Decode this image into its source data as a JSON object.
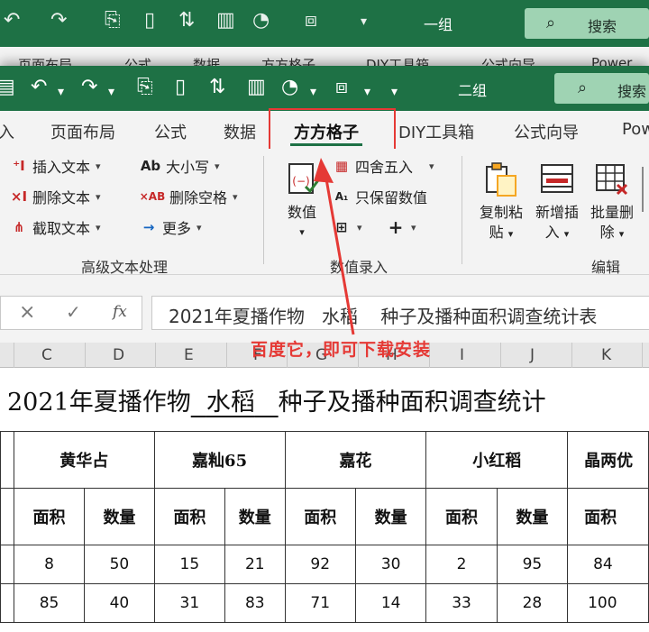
{
  "bg_window": {
    "group_label": "一组",
    "search_label": "搜索",
    "tabs": [
      "页面布局",
      "公式",
      "数据",
      "方方格子",
      "DIY工具箱",
      "公式向导",
      "Power"
    ]
  },
  "window": {
    "group_label": "二组",
    "search_label": "搜索",
    "tabs": [
      "入",
      "页面布局",
      "公式",
      "数据",
      "方方格子",
      "DIY工具箱",
      "公式向导",
      "Pow"
    ],
    "active_tab": "方方格子"
  },
  "ribbon": {
    "text_group": {
      "insert_text": "插入文本",
      "delete_text": "删除文本",
      "extract_text": "截取文本",
      "case": "大小写",
      "delete_space": "删除空格",
      "more": "更多",
      "label": "高级文本处理"
    },
    "number_group": {
      "value_btn": "数值",
      "round": "四舍五入",
      "keep_values": "只保留数值",
      "label": "数值录入"
    },
    "edit_group": {
      "copy_paste": [
        "复制粘",
        "贴"
      ],
      "insert_new": [
        "新增插",
        "入"
      ],
      "batch_delete": [
        "批量删",
        "除"
      ],
      "label": "编辑"
    }
  },
  "formula_bar": {
    "content": "2021年夏播作物   水稻    种子及播种面积调查统计表"
  },
  "columns": [
    "C",
    "D",
    "E",
    "F",
    "G",
    "H",
    "I",
    "J",
    "K"
  ],
  "annotation": "百度它，即可下载安装",
  "sheet": {
    "title_pre": "2021年夏播作物",
    "title_crop": "水稻",
    "title_post": "种子及播种面积调查统计",
    "varieties": [
      "黄华占",
      "嘉籼65",
      "嘉花",
      "小红稻",
      "晶两优"
    ],
    "sub_headers": [
      "面积",
      "数量",
      "面积",
      "数量",
      "面积",
      "数量",
      "面积",
      "数量",
      "面积"
    ],
    "rows": [
      [
        "8",
        "50",
        "15",
        "21",
        "92",
        "30",
        "2",
        "95",
        "84"
      ],
      [
        "85",
        "40",
        "31",
        "83",
        "71",
        "14",
        "33",
        "28",
        "100"
      ]
    ]
  },
  "colors": {
    "excel_green": "#1e7145",
    "highlight_red": "#e53935",
    "search_box": "#9fd3b3"
  }
}
